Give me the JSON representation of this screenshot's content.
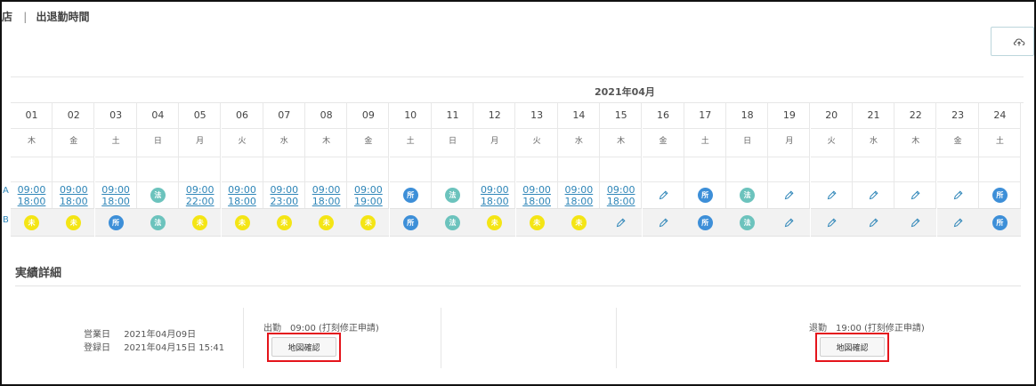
{
  "header": {
    "title_prefix": "店",
    "separator": "|",
    "title": "出退勤時間"
  },
  "toolbar": {
    "upload_icon": "cloud-upload-icon"
  },
  "calendar": {
    "month": "2021年04月",
    "row_labels": [
      "A",
      "B"
    ],
    "days": [
      {
        "day": "01",
        "weekday": "木",
        "a": {
          "type": "time",
          "in": "09:00",
          "out": "18:00"
        },
        "b": {
          "type": "badge",
          "text": "未",
          "color": "yellow"
        }
      },
      {
        "day": "02",
        "weekday": "金",
        "a": {
          "type": "time",
          "in": "09:00",
          "out": "18:00"
        },
        "b": {
          "type": "badge",
          "text": "未",
          "color": "yellow"
        }
      },
      {
        "day": "03",
        "weekday": "土",
        "a": {
          "type": "time",
          "in": "09:00",
          "out": "18:00"
        },
        "b": {
          "type": "badge",
          "text": "所",
          "color": "blue"
        }
      },
      {
        "day": "04",
        "weekday": "日",
        "a": {
          "type": "badge",
          "text": "法",
          "color": "teal"
        },
        "b": {
          "type": "badge",
          "text": "法",
          "color": "teal"
        }
      },
      {
        "day": "05",
        "weekday": "月",
        "a": {
          "type": "time",
          "in": "09:00",
          "out": "22:00"
        },
        "b": {
          "type": "badge",
          "text": "未",
          "color": "yellow"
        }
      },
      {
        "day": "06",
        "weekday": "火",
        "a": {
          "type": "time",
          "in": "09:00",
          "out": "18:00"
        },
        "b": {
          "type": "badge",
          "text": "未",
          "color": "yellow"
        }
      },
      {
        "day": "07",
        "weekday": "水",
        "a": {
          "type": "time",
          "in": "09:00",
          "out": "23:00"
        },
        "b": {
          "type": "badge",
          "text": "未",
          "color": "yellow"
        }
      },
      {
        "day": "08",
        "weekday": "木",
        "a": {
          "type": "time",
          "in": "09:00",
          "out": "18:00"
        },
        "b": {
          "type": "badge",
          "text": "未",
          "color": "yellow"
        }
      },
      {
        "day": "09",
        "weekday": "金",
        "a": {
          "type": "time",
          "in": "09:00",
          "out": "19:00"
        },
        "b": {
          "type": "badge",
          "text": "未",
          "color": "yellow"
        }
      },
      {
        "day": "10",
        "weekday": "土",
        "a": {
          "type": "badge",
          "text": "所",
          "color": "blue"
        },
        "b": {
          "type": "badge",
          "text": "所",
          "color": "blue"
        }
      },
      {
        "day": "11",
        "weekday": "日",
        "a": {
          "type": "badge",
          "text": "法",
          "color": "teal"
        },
        "b": {
          "type": "badge",
          "text": "法",
          "color": "teal"
        }
      },
      {
        "day": "12",
        "weekday": "月",
        "a": {
          "type": "time",
          "in": "09:00",
          "out": "18:00"
        },
        "b": {
          "type": "badge",
          "text": "未",
          "color": "yellow"
        }
      },
      {
        "day": "13",
        "weekday": "火",
        "a": {
          "type": "time",
          "in": "09:00",
          "out": "18:00"
        },
        "b": {
          "type": "badge",
          "text": "未",
          "color": "yellow"
        }
      },
      {
        "day": "14",
        "weekday": "水",
        "a": {
          "type": "time",
          "in": "09:00",
          "out": "18:00"
        },
        "b": {
          "type": "badge",
          "text": "未",
          "color": "yellow"
        }
      },
      {
        "day": "15",
        "weekday": "木",
        "a": {
          "type": "time",
          "in": "09:00",
          "out": "18:00"
        },
        "b": {
          "type": "edit"
        }
      },
      {
        "day": "16",
        "weekday": "金",
        "a": {
          "type": "edit"
        },
        "b": {
          "type": "edit"
        }
      },
      {
        "day": "17",
        "weekday": "土",
        "a": {
          "type": "badge",
          "text": "所",
          "color": "blue"
        },
        "b": {
          "type": "badge",
          "text": "所",
          "color": "blue"
        }
      },
      {
        "day": "18",
        "weekday": "日",
        "a": {
          "type": "badge",
          "text": "法",
          "color": "teal"
        },
        "b": {
          "type": "badge",
          "text": "法",
          "color": "teal"
        }
      },
      {
        "day": "19",
        "weekday": "月",
        "a": {
          "type": "edit"
        },
        "b": {
          "type": "edit"
        }
      },
      {
        "day": "20",
        "weekday": "火",
        "a": {
          "type": "edit"
        },
        "b": {
          "type": "edit"
        }
      },
      {
        "day": "21",
        "weekday": "水",
        "a": {
          "type": "edit"
        },
        "b": {
          "type": "edit"
        }
      },
      {
        "day": "22",
        "weekday": "木",
        "a": {
          "type": "edit"
        },
        "b": {
          "type": "edit"
        }
      },
      {
        "day": "23",
        "weekday": "金",
        "a": {
          "type": "edit"
        },
        "b": {
          "type": "edit"
        }
      },
      {
        "day": "24",
        "weekday": "土",
        "a": {
          "type": "badge",
          "text": "所",
          "color": "blue"
        },
        "b": {
          "type": "badge",
          "text": "所",
          "color": "blue"
        }
      }
    ]
  },
  "details": {
    "title": "実績詳細",
    "business_day_label": "営業日",
    "business_day_value": "2021年04月09日",
    "registered_label": "登録日",
    "registered_value": "2021年04月15日 15:41",
    "clock_in_text": "出勤　09:00 (打刻修正申請)",
    "clock_out_text": "退勤　19:00 (打刻修正申請)",
    "map_button_label": "地図確認"
  },
  "colors": {
    "link": "#2f86b8",
    "badge_yellow": "#f4e515",
    "badge_blue": "#3d8fd8",
    "badge_teal": "#6cc3bd",
    "highlight": "#e4141b"
  }
}
